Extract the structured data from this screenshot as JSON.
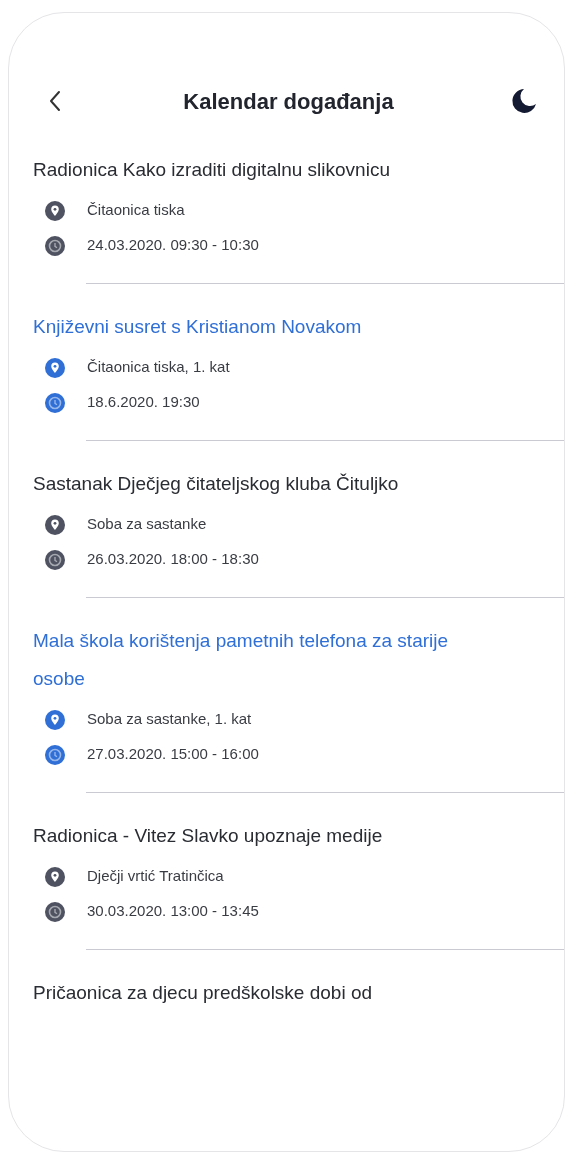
{
  "header": {
    "title": "Kalendar događanja"
  },
  "events": [
    {
      "title": "Radionica Kako izraditi digitalnu slikovnicu",
      "highlighted": false,
      "location": "Čitaonica tiska",
      "time": "24.03.2020. 09:30 - 10:30"
    },
    {
      "title": "Književni susret s Kristianom Novakom",
      "highlighted": true,
      "location": "Čitaonica tiska, 1. kat",
      "time": "18.6.2020. 19:30"
    },
    {
      "title": "Sastanak Dječjeg čitateljskog kluba Čituljko",
      "highlighted": false,
      "location": "Soba za sastanke",
      "time": "26.03.2020. 18:00 - 18:30"
    },
    {
      "title": "Mala škola korištenja pametnih telefona za starije osobe",
      "highlighted": true,
      "location": "Soba za sastanke, 1. kat",
      "time": "27.03.2020. 15:00 - 16:00"
    },
    {
      "title": "Radionica - Vitez Slavko upoznaje medije",
      "highlighted": false,
      "location": "Dječji vrtić Tratinčica",
      "time": "30.03.2020. 13:00 - 13:45"
    },
    {
      "title": "Pričaonica za djecu predškolske dobi od",
      "highlighted": false
    }
  ]
}
